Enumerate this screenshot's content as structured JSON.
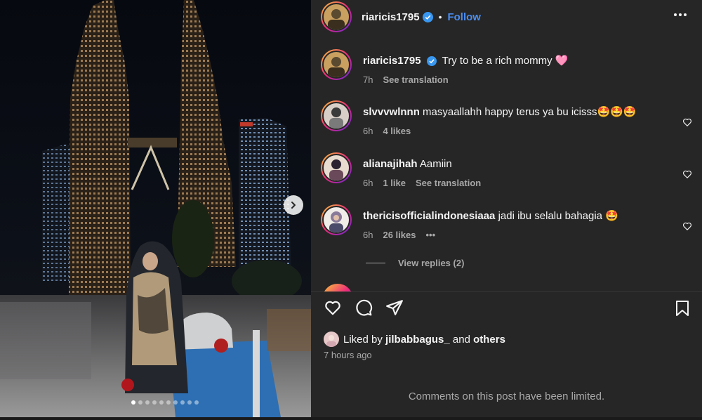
{
  "post": {
    "username": "riaricis1795",
    "follow_label": "Follow",
    "separator": "•",
    "caption": {
      "username": "riaricis1795",
      "text": "Try to be a rich mommy 🩷",
      "time": "7h",
      "translation_label": "See translation"
    }
  },
  "photo": {
    "slide_count": 10,
    "active_slide": 1
  },
  "comments": [
    {
      "username": "slvvvwlnnn",
      "text": "masyaallahh happy terus ya bu icisss🤩🤩🤩",
      "time": "6h",
      "likes": "4 likes",
      "translation": ""
    },
    {
      "username": "alianajihah",
      "text": "Aamiin",
      "time": "6h",
      "likes": "1 like",
      "translation": "See translation"
    },
    {
      "username": "thericisofficialindonesiaaa",
      "text": "jadi ibu selalu bahagia 🤩",
      "time": "6h",
      "likes": "26 likes",
      "translation": "",
      "more": "•••"
    }
  ],
  "view_replies": "View replies (2)",
  "likes": {
    "prefix": "Liked by",
    "user": "jilbabbagus_",
    "conj": "and",
    "others": "others"
  },
  "timestamp": "7 hours ago",
  "limited_notice": "Comments on this post have been limited.",
  "colors": {
    "panel_bg": "#262626",
    "accent": "#4a8ef3",
    "secondary_text": "#a8a8a8",
    "verified": "#3897f0"
  }
}
